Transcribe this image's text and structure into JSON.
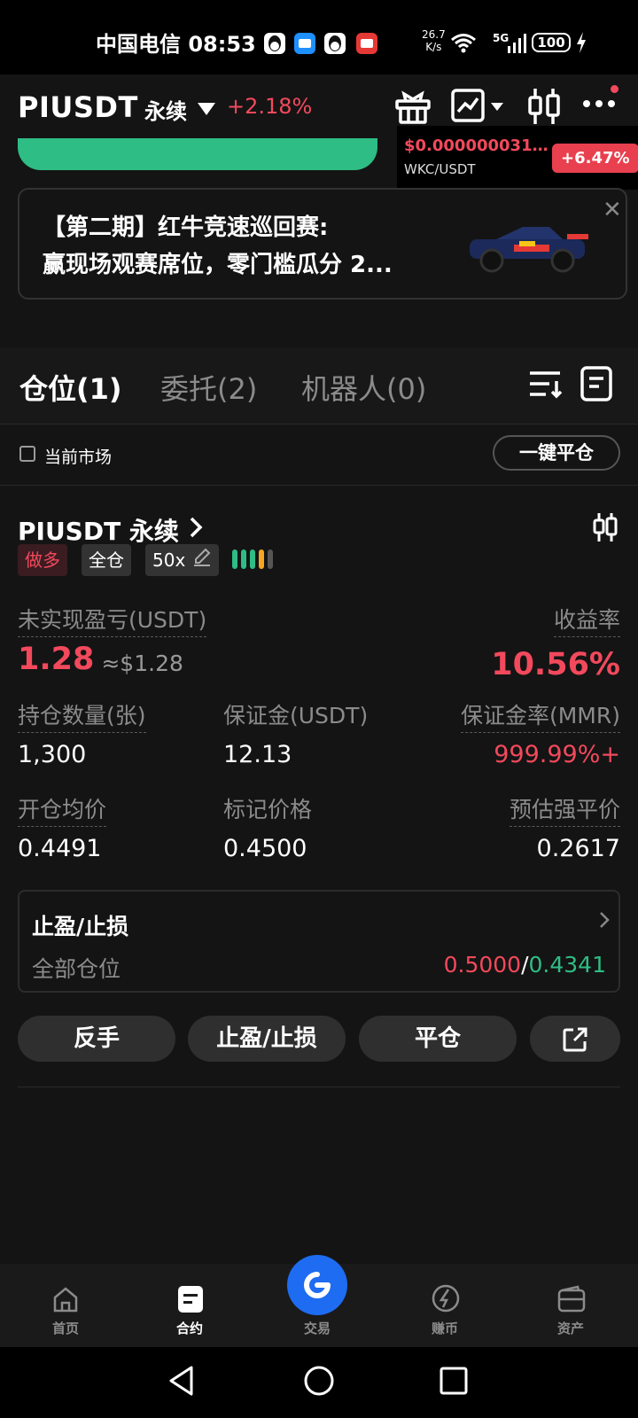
{
  "status_bar": {
    "carrier_time": "中国电信 08:53",
    "net_speed_value": "26.7",
    "net_speed_unit": "K/s",
    "network": "5G",
    "battery": "100"
  },
  "header": {
    "pair": "PIUSDT",
    "contract_type": "永续",
    "change": "+2.18%"
  },
  "ticker": {
    "price": "$0.0000000317...",
    "pair": "WKC/USDT",
    "change": "+6.47%"
  },
  "banner": {
    "line1": "【第二期】红牛竞速巡回赛:",
    "line2": "赢现场观赛席位，零门槛瓜分 2..."
  },
  "tabs": [
    {
      "label": "仓位(1)"
    },
    {
      "label": "委托(2)"
    },
    {
      "label": "机器人(0)"
    }
  ],
  "filter": {
    "current_market": "当前市场",
    "close_all": "一键平仓"
  },
  "position": {
    "title": "PIUSDT 永续",
    "side": "做多",
    "margin_mode": "全仓",
    "leverage": "50x",
    "unrealized_pnl_label": "未实现盈亏(USDT)",
    "unrealized_pnl": "1.28",
    "unrealized_pnl_usd": "≈$1.28",
    "roe_label": "收益率",
    "roe": "10.56%",
    "size_label": "持仓数量(张)",
    "size": "1,300",
    "margin_label": "保证金(USDT)",
    "margin": "12.13",
    "mmr_label": "保证金率(MMR)",
    "mmr": "999.99%+",
    "entry_label": "开仓均价",
    "entry": "0.4491",
    "mark_label": "标记价格",
    "mark": "0.4500",
    "liq_label": "预估强平价",
    "liq": "0.2617"
  },
  "tpsl": {
    "title": "止盈/止损",
    "scope": "全部仓位",
    "tp": "0.5000",
    "separator": "/",
    "sl": "0.4341"
  },
  "actions": {
    "reverse": "反手",
    "tpsl": "止盈/止损",
    "close": "平仓"
  },
  "bottom_nav": [
    {
      "label": "首页"
    },
    {
      "label": "合约"
    },
    {
      "label": "交易"
    },
    {
      "label": "赚币"
    },
    {
      "label": "资产"
    }
  ],
  "colors": {
    "profit_red": "#f2495c",
    "loss_green": "#2ebd85",
    "accent_blue": "#1e6cf2"
  }
}
